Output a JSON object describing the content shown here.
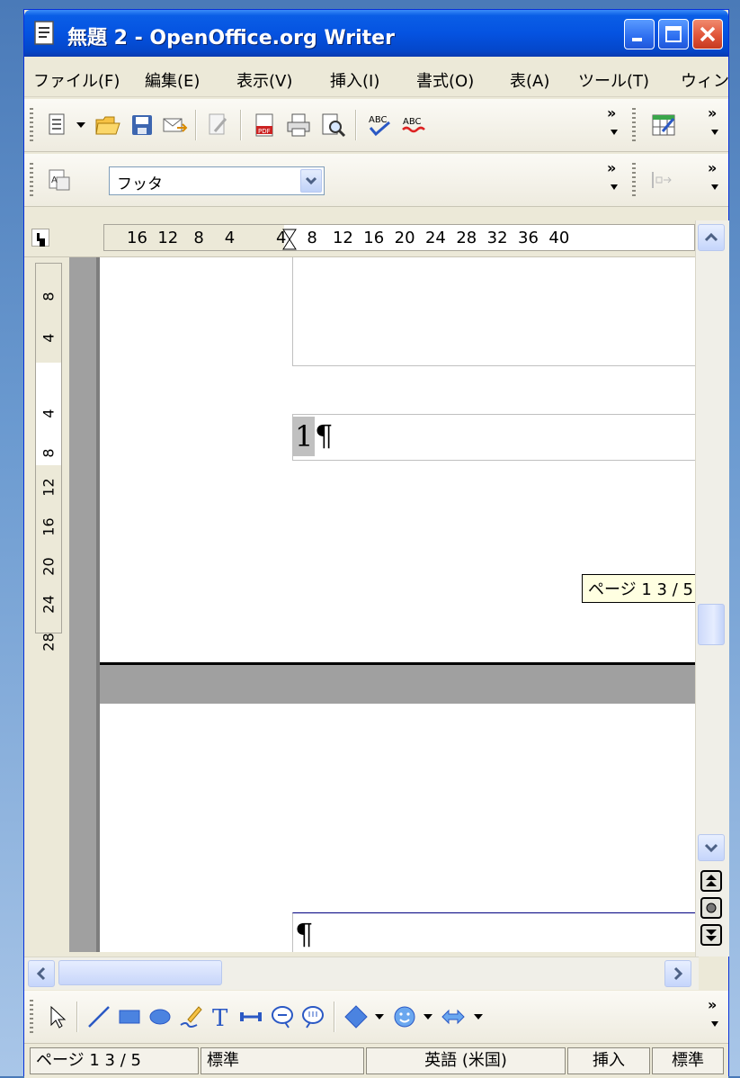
{
  "window": {
    "title": "無題 2 - OpenOffice.org Writer"
  },
  "menubar": [
    "ファイル(F)",
    "編集(E)",
    "表示(V)",
    "挿入(I)",
    "書式(O)",
    "表(A)",
    "ツール(T)",
    "ウィン"
  ],
  "formatting": {
    "paragraph_style": "フッタ"
  },
  "ruler": {
    "horizontal": "16  12   8    4        4    8   12  16  20  24  28  32  36  40",
    "vertical": [
      "8",
      "4",
      "4",
      "8",
      "12",
      "16",
      "20",
      "24",
      "28"
    ]
  },
  "document": {
    "page_number_field": "1",
    "pilcrow": "¶",
    "tooltip": "ページ 1   3 / 5"
  },
  "statusbar": {
    "page": "ページ 1   3 / 5",
    "style": "標準",
    "language": "英語 (米国)",
    "insert_mode": "挿入",
    "selection_mode": "標準"
  },
  "icons": {
    "standard_toolbar": [
      "new-document-icon",
      "open-folder-icon",
      "save-icon",
      "email-icon",
      "edit-file-icon",
      "export-pdf-icon",
      "print-icon",
      "page-preview-icon",
      "spellcheck-icon",
      "autospellcheck-icon",
      "table-icon"
    ],
    "drawing_toolbar": [
      "select-pointer-icon",
      "line-icon",
      "rectangle-icon",
      "ellipse-icon",
      "freeform-icon",
      "text-icon",
      "connector-icon",
      "callout-icon",
      "comment-callout-icon",
      "basic-shape-icon",
      "smiley-icon",
      "double-arrow-icon"
    ]
  },
  "colors": {
    "titlebar": "#0553e1",
    "close_button": "#e0553a",
    "tooltip_bg": "#ffffe1"
  }
}
